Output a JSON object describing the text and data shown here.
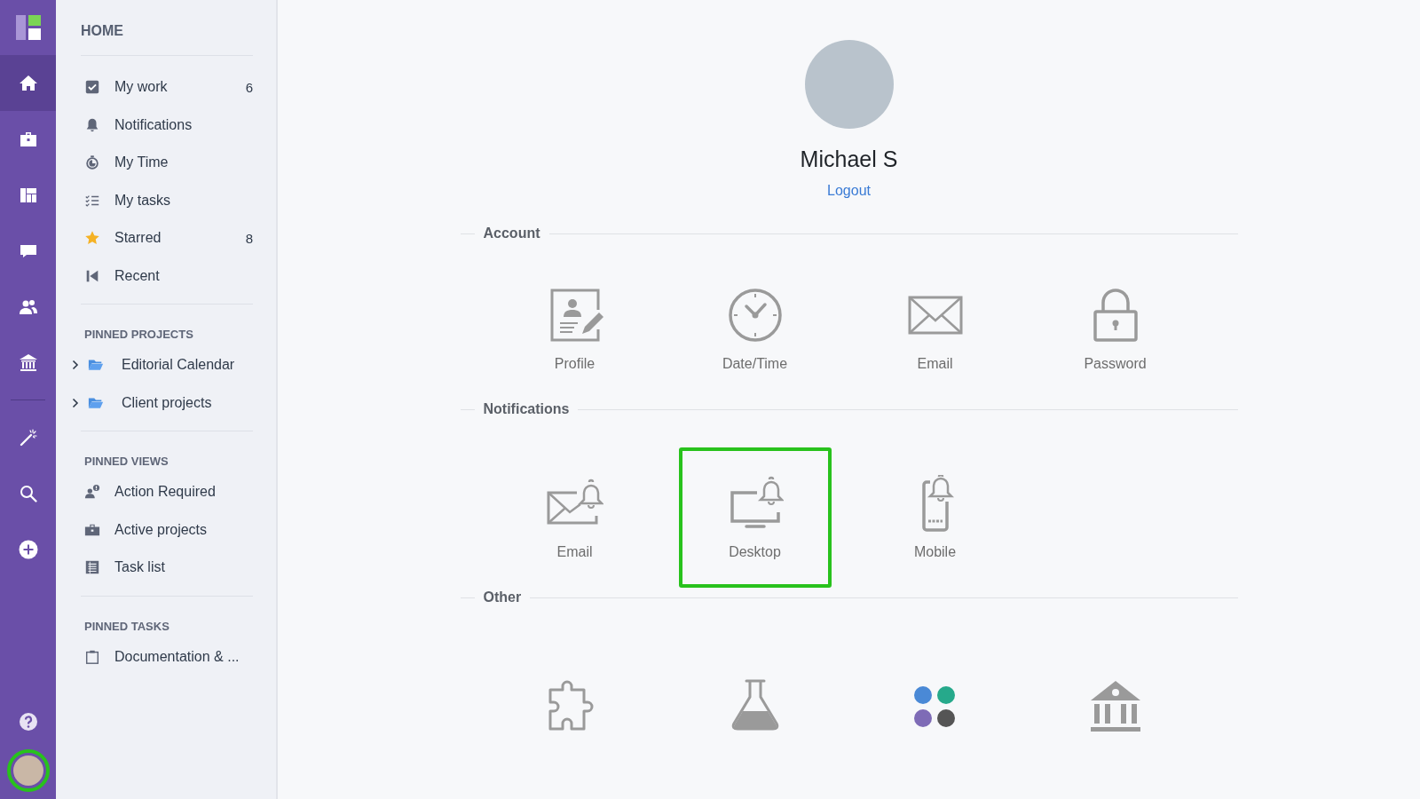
{
  "rail": {
    "items": [
      {
        "kind": "home",
        "selected": true
      },
      {
        "kind": "briefcase",
        "selected": false
      },
      {
        "kind": "layout",
        "selected": false
      },
      {
        "kind": "chat",
        "selected": false
      },
      {
        "kind": "people",
        "selected": false
      },
      {
        "kind": "bank",
        "selected": false
      },
      {
        "kind": "wand",
        "selected": false
      },
      {
        "kind": "search",
        "selected": false
      },
      {
        "kind": "plus",
        "selected": false
      }
    ],
    "bottom": [
      {
        "kind": "help",
        "highlighted": false
      },
      {
        "kind": "avatar",
        "highlighted": true
      }
    ]
  },
  "sidebar": {
    "title": "HOME",
    "items": [
      {
        "kind": "check",
        "label": "My work",
        "count": "6"
      },
      {
        "kind": "bell",
        "label": "Notifications"
      },
      {
        "kind": "timer",
        "label": "My Time"
      },
      {
        "kind": "tasks",
        "label": "My tasks"
      },
      {
        "kind": "star",
        "label": "Starred",
        "count": "8"
      },
      {
        "kind": "recent",
        "label": "Recent"
      }
    ],
    "sections": [
      {
        "title": "PINNED PROJECTS",
        "items": [
          {
            "kind": "folder",
            "label": "Editorial Calendar",
            "expanded": false
          },
          {
            "kind": "folder",
            "label": "Client projects",
            "expanded": false
          }
        ]
      },
      {
        "title": "PINNED VIEWS",
        "items": [
          {
            "kind": "user-alert",
            "label": "Action Required"
          },
          {
            "kind": "briefcase",
            "label": "Active projects"
          },
          {
            "kind": "list",
            "label": "Task list"
          }
        ]
      },
      {
        "title": "PINNED TASKS",
        "items": [
          {
            "kind": "clipboard",
            "label": "Documentation & ..."
          }
        ]
      }
    ]
  },
  "profile": {
    "name": "Michael S",
    "logout": "Logout"
  },
  "sections": [
    {
      "title": "Account",
      "tiles": [
        {
          "kind": "profile",
          "label": "Profile",
          "highlighted": false
        },
        {
          "kind": "clock",
          "label": "Date/Time",
          "highlighted": false
        },
        {
          "kind": "envelope",
          "label": "Email",
          "highlighted": false
        },
        {
          "kind": "lock",
          "label": "Password",
          "highlighted": false
        }
      ]
    },
    {
      "title": "Notifications",
      "tiles": [
        {
          "kind": "mail-bell",
          "label": "Email",
          "highlighted": false
        },
        {
          "kind": "desktop-bell",
          "label": "Desktop",
          "highlighted": true
        },
        {
          "kind": "mobile-bell",
          "label": "Mobile",
          "highlighted": false
        }
      ]
    },
    {
      "title": "Other",
      "tiles": [
        {
          "kind": "puzzle",
          "highlighted": false
        },
        {
          "kind": "flask",
          "highlighted": false
        },
        {
          "kind": "dots",
          "highlighted": false
        },
        {
          "kind": "bank",
          "highlighted": false
        }
      ]
    }
  ]
}
